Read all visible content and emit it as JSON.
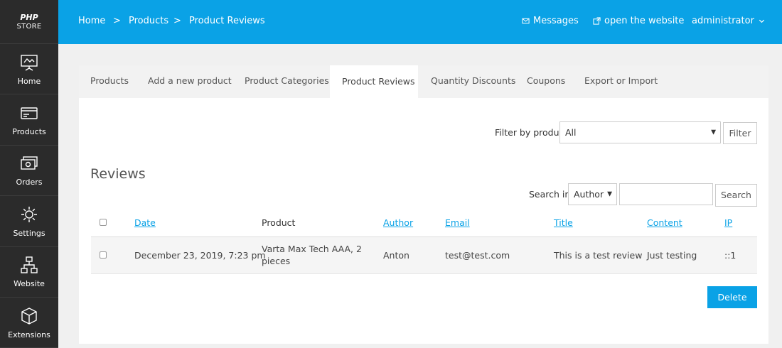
{
  "brand": {
    "line1": "PHP",
    "line2": "STORE"
  },
  "sidebar": {
    "items": [
      {
        "label": "Home",
        "icon": "presentation-board-icon"
      },
      {
        "label": "Products",
        "icon": "card-icon"
      },
      {
        "label": "Orders",
        "icon": "cash-icon"
      },
      {
        "label": "Settings",
        "icon": "gear-icon"
      },
      {
        "label": "Website",
        "icon": "sitemap-icon"
      },
      {
        "label": "Extensions",
        "icon": "cube-icon"
      }
    ]
  },
  "topbar": {
    "breadcrumb": [
      "Home",
      "Products",
      "Product Reviews"
    ],
    "separator": ">",
    "messages": "Messages",
    "open_website": "open the website",
    "user": "administrator"
  },
  "tabs": [
    {
      "label": "Products"
    },
    {
      "label": "Add a new product"
    },
    {
      "label": "Product Categories"
    },
    {
      "label": "Product Reviews",
      "active": true
    },
    {
      "label": "Quantity Discounts"
    },
    {
      "label": "Coupons"
    },
    {
      "label": "Export or Import"
    }
  ],
  "filter": {
    "label": "Filter by product:",
    "value": "All",
    "button": "Filter"
  },
  "reviews": {
    "heading": "Reviews",
    "search_label": "Search in:",
    "search_field": "Author",
    "search_value": "",
    "search_button": "Search",
    "columns": [
      "Date",
      "Product",
      "Author",
      "Email",
      "Title",
      "Content",
      "IP"
    ],
    "rows": [
      {
        "date": "December 23, 2019, 7:23 pm",
        "product_line1": "Varta Max Tech AAA, 2",
        "product_line2": "pieces",
        "author": "Anton",
        "email": "test@test.com",
        "title": "This is a test review",
        "content": "Just testing",
        "ip": "::1"
      }
    ],
    "delete_button": "Delete"
  },
  "colors": {
    "accent": "#0aa2e6",
    "sidebar": "#2b2b2b"
  }
}
